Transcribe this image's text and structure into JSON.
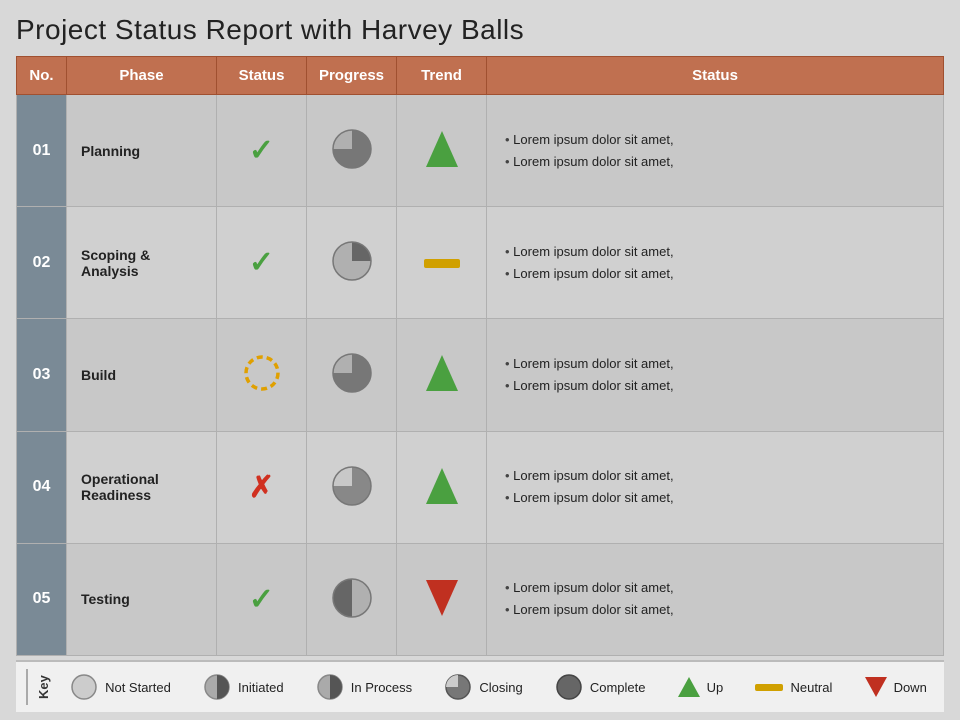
{
  "title": "Project Status Report with Harvey Balls",
  "table": {
    "headers": [
      "No.",
      "Phase",
      "Status",
      "Progress",
      "Trend",
      "Status"
    ],
    "rows": [
      {
        "no": "01",
        "phase": "Planning",
        "status_type": "check",
        "progress_type": "three-quarter",
        "trend_type": "up",
        "desc": [
          "Lorem ipsum dolor sit amet,",
          "Lorem ipsum dolor sit amet,"
        ]
      },
      {
        "no": "02",
        "phase": "Scoping & Analysis",
        "status_type": "check",
        "progress_type": "half",
        "trend_type": "neutral",
        "desc": [
          "Lorem ipsum dolor sit amet,",
          "Lorem ipsum dolor sit amet,"
        ]
      },
      {
        "no": "03",
        "phase": "Build",
        "status_type": "warn",
        "progress_type": "three-quarter",
        "trend_type": "up",
        "desc": [
          "Lorem ipsum dolor sit amet,",
          "Lorem ipsum dolor sit amet,"
        ]
      },
      {
        "no": "04",
        "phase": "Operational Readiness",
        "status_type": "cross",
        "progress_type": "quarter-right",
        "trend_type": "up",
        "desc": [
          "Lorem ipsum dolor sit amet,",
          "Lorem ipsum dolor sit amet,"
        ]
      },
      {
        "no": "05",
        "phase": "Testing",
        "status_type": "check",
        "progress_type": "half-left",
        "trend_type": "down",
        "desc": [
          "Lorem ipsum dolor sit amet,",
          "Lorem ipsum dolor sit amet,"
        ]
      }
    ]
  },
  "legend": {
    "key_label": "Key",
    "items": [
      {
        "type": "not-started",
        "label": "Not Started"
      },
      {
        "type": "initiated",
        "label": "Initiated"
      },
      {
        "type": "in-process",
        "label": "In Process"
      },
      {
        "type": "closing",
        "label": "Closing"
      },
      {
        "type": "complete",
        "label": "Complete"
      },
      {
        "type": "up",
        "label": "Up"
      },
      {
        "type": "neutral",
        "label": "Neutral"
      },
      {
        "type": "down",
        "label": "Down"
      }
    ]
  }
}
